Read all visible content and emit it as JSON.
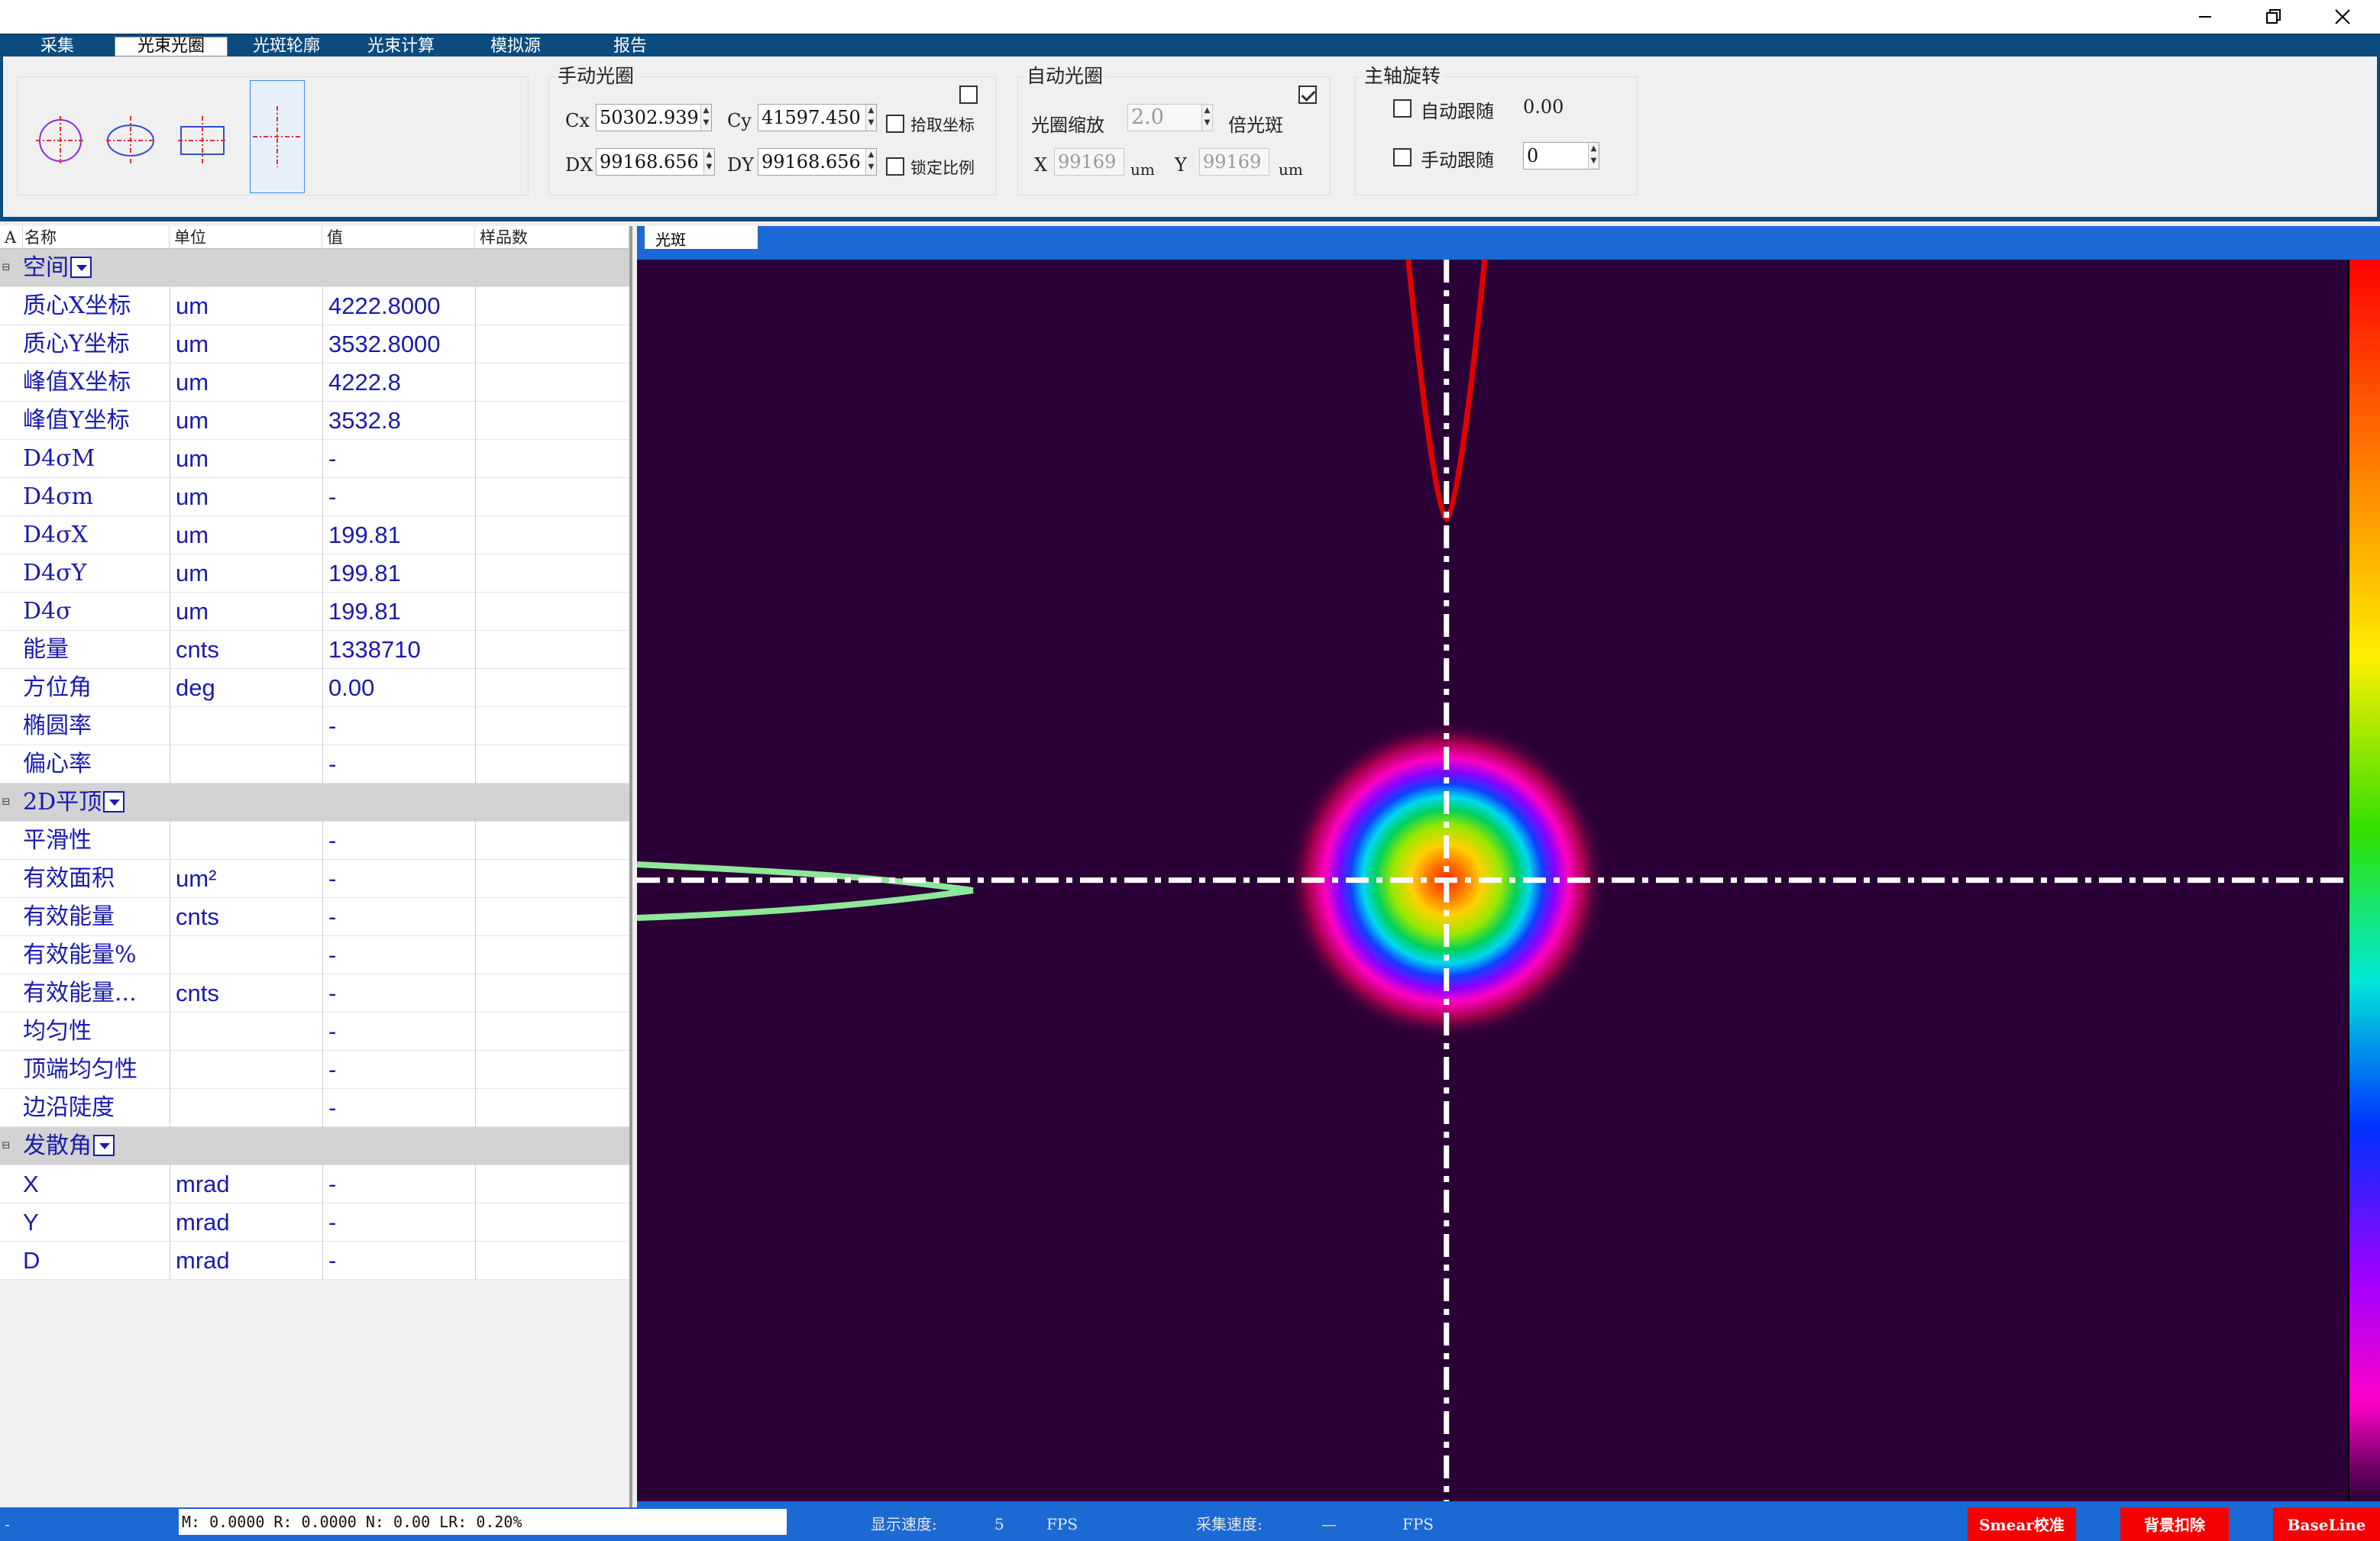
{
  "menu": {
    "items": [
      "采集",
      "光束光圈",
      "光斑轮廓",
      "光束计算",
      "模拟源",
      "报告"
    ],
    "active_index": 1
  },
  "window_controls": [
    "minimize",
    "restore",
    "close"
  ],
  "toolbar": {
    "shapes": [
      "ellipse-shape",
      "ellipse-shape-small",
      "rectangle-shape",
      "crosshair-shape"
    ],
    "manual": {
      "title": "手动光圈",
      "cx_label": "Cx",
      "cx_value": "50302.939",
      "cy_label": "Cy",
      "cy_value": "41597.450",
      "dx_label": "DX",
      "dx_value": "99168.656",
      "dy_label": "DY",
      "dy_value": "99168.656",
      "pick_label": "拾取坐标",
      "lock_label": "锁定比例",
      "enabled_checked": false
    },
    "auto": {
      "title": "自动光圈",
      "scale_label": "光圈缩放",
      "scale_value": "2.0",
      "scale_unit": "倍光斑",
      "x_label": "X",
      "x_value": "99169",
      "x_unit": "um",
      "y_label": "Y",
      "y_value": "99169",
      "y_unit": "um",
      "enabled_checked": true
    },
    "rotation": {
      "title": "主轴旋转",
      "auto_label": "自动跟随",
      "auto_value": "0.00",
      "manual_label": "手动跟随",
      "manual_value": "0"
    }
  },
  "grid": {
    "corner": "A",
    "headers": [
      "名称",
      "单位",
      "值",
      "样品数"
    ],
    "rows": [
      {
        "group": true,
        "name": "空间"
      },
      {
        "name": "质心X坐标",
        "unit": "um",
        "value": "4222.8000"
      },
      {
        "name": "质心Y坐标",
        "unit": "um",
        "value": "3532.8000"
      },
      {
        "name": "峰值X坐标",
        "unit": "um",
        "value": "4222.8"
      },
      {
        "name": "峰值Y坐标",
        "unit": "um",
        "value": "3532.8"
      },
      {
        "name": "D4σM",
        "unit": "um",
        "value": "-"
      },
      {
        "name": "D4σm",
        "unit": "um",
        "value": "-"
      },
      {
        "name": "D4σX",
        "unit": "um",
        "value": "199.81"
      },
      {
        "name": "D4σY",
        "unit": "um",
        "value": "199.81"
      },
      {
        "name": "D4σ",
        "unit": "um",
        "value": "199.81"
      },
      {
        "name": "能量",
        "unit": "cnts",
        "value": "1338710"
      },
      {
        "name": "方位角",
        "unit": "deg",
        "value": "0.00"
      },
      {
        "name": "椭圆率",
        "unit": "",
        "value": "-"
      },
      {
        "name": "偏心率",
        "unit": "",
        "value": "-"
      },
      {
        "group": true,
        "name": "2D平顶"
      },
      {
        "name": "平滑性",
        "unit": "",
        "value": "-"
      },
      {
        "name": "有效面积",
        "unit": "um²",
        "value": "-"
      },
      {
        "name": "有效能量",
        "unit": "cnts",
        "value": "-"
      },
      {
        "name": "有效能量%",
        "unit": "",
        "value": "-"
      },
      {
        "name": "有效能量...",
        "unit": "cnts",
        "value": "-"
      },
      {
        "name": "均匀性",
        "unit": "",
        "value": "-"
      },
      {
        "name": "顶端均匀性",
        "unit": "",
        "value": "-"
      },
      {
        "name": "边沿陡度",
        "unit": "",
        "value": "-"
      },
      {
        "group": true,
        "name": "发散角"
      },
      {
        "name": "X",
        "unit": "mrad",
        "value": "-"
      },
      {
        "name": "Y",
        "unit": "mrad",
        "value": "-"
      },
      {
        "name": "D",
        "unit": "mrad",
        "value": "-"
      }
    ]
  },
  "view": {
    "tab_label": "光斑",
    "background_color": "#2b0036",
    "beam_center_fraction": [
      0.4644,
      0.4973
    ],
    "colorbar": "rainbow"
  },
  "status": {
    "left_mark": "-",
    "metrics": "M: 0.0000   R: 0.0000   N: 0.00   LR: 0.20%",
    "display_speed_label": "显示速度:",
    "display_speed_value": "5",
    "display_speed_unit": "FPS",
    "capture_speed_label": "采集速度:",
    "capture_speed_value": "—",
    "capture_speed_unit": "FPS",
    "buttons": [
      "Smear校准",
      "背景扣除",
      "BaseLine"
    ]
  }
}
